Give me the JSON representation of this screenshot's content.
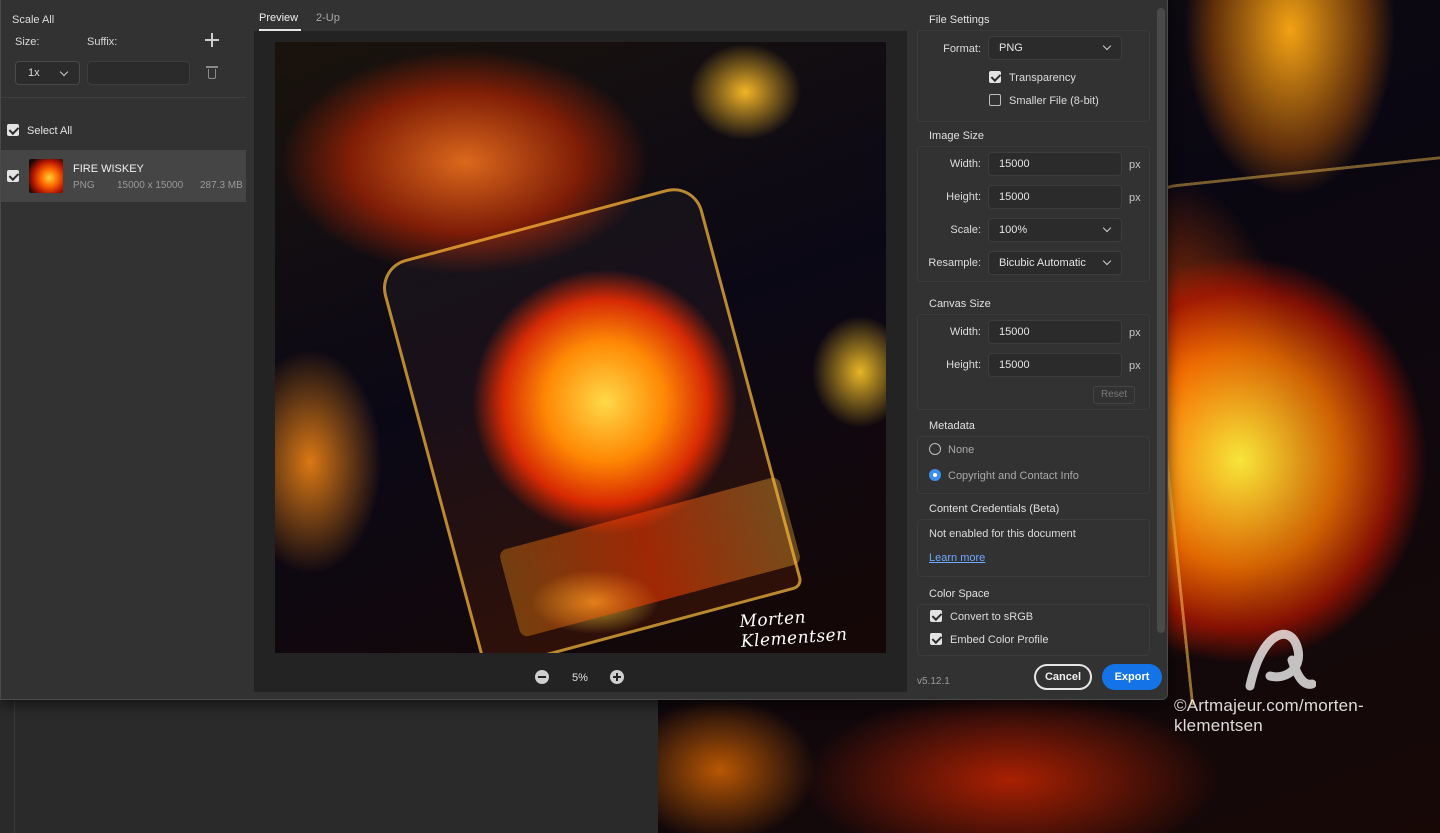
{
  "left_panel": {
    "title": "Scale All",
    "size_label": "Size:",
    "suffix_label": "Suffix:",
    "size_value": "1x",
    "suffix_value": "",
    "select_all_label": "Select All",
    "asset": {
      "name": "FIRE WISKEY",
      "format": "PNG",
      "dimensions": "15000 x 15000",
      "filesize": "287.3 MB"
    }
  },
  "preview": {
    "tabs": [
      "Preview",
      "2-Up"
    ],
    "active_tab": "Preview",
    "signature": "Morten Klementsen",
    "zoom": "5%"
  },
  "file_settings": {
    "title": "File Settings",
    "format_label": "Format:",
    "format_value": "PNG",
    "transparency_label": "Transparency",
    "transparency_checked": true,
    "smaller_file_label": "Smaller File (8-bit)",
    "smaller_file_checked": false
  },
  "image_size": {
    "title": "Image Size",
    "width_label": "Width:",
    "width_value": "15000",
    "height_label": "Height:",
    "height_value": "15000",
    "scale_label": "Scale:",
    "scale_value": "100%",
    "resample_label": "Resample:",
    "resample_value": "Bicubic Automatic",
    "unit": "px"
  },
  "canvas_size": {
    "title": "Canvas Size",
    "width_label": "Width:",
    "width_value": "15000",
    "height_label": "Height:",
    "height_value": "15000",
    "unit": "px",
    "reset_label": "Reset"
  },
  "metadata": {
    "title": "Metadata",
    "options": [
      "None",
      "Copyright and Contact Info"
    ],
    "selected": "Copyright and Contact Info"
  },
  "content_credentials": {
    "title": "Content Credentials (Beta)",
    "status": "Not enabled for this document",
    "link": "Learn more"
  },
  "color_space": {
    "title": "Color Space",
    "convert_label": "Convert to sRGB",
    "convert_checked": true,
    "embed_label": "Embed Color Profile",
    "embed_checked": true
  },
  "footer": {
    "version": "v5.12.1",
    "cancel_label": "Cancel",
    "export_label": "Export"
  },
  "watermark": {
    "text": "©Artmajeur.com/morten-klementsen"
  },
  "colors": {
    "accent": "#1473e6",
    "radio_selected": "#3b8ff0",
    "link": "#6ea8ff",
    "dialog_bg": "#323232"
  },
  "icons": [
    "plus-icon",
    "trash-icon",
    "chevron-down-icon",
    "zoom-out-icon",
    "zoom-in-icon",
    "checkbox-icon",
    "radio-icon"
  ]
}
